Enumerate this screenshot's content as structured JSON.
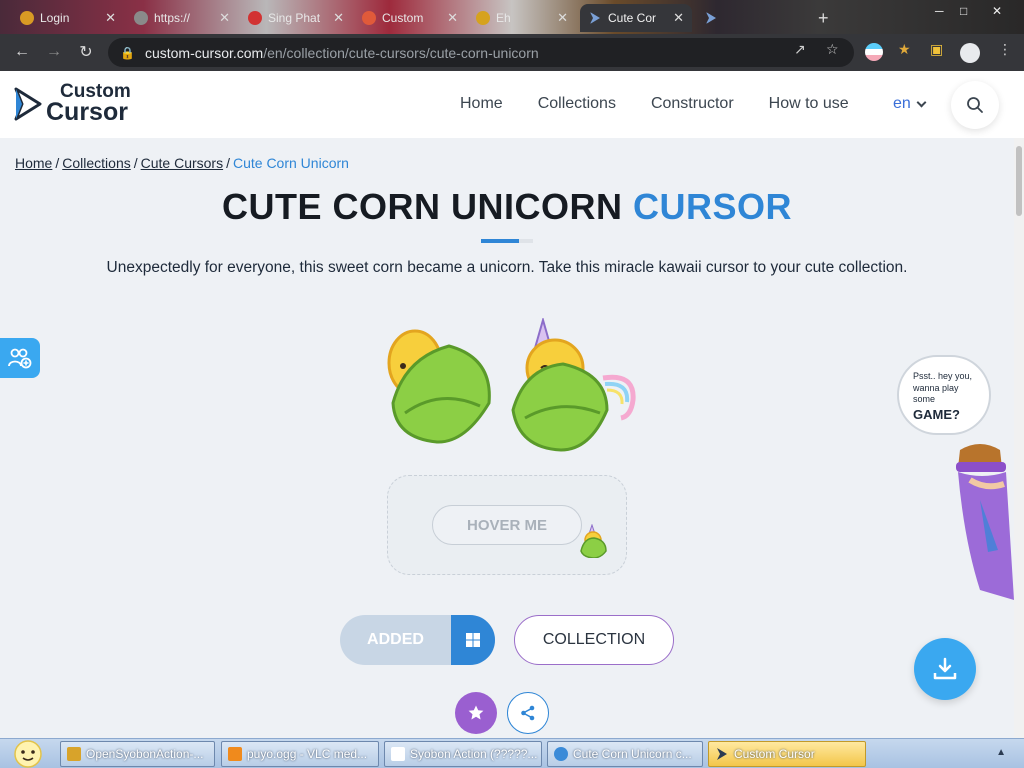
{
  "browser": {
    "tabs": [
      {
        "label": "Login",
        "color": "#d89a24"
      },
      {
        "label": "https://",
        "color": "#8a8a8a"
      },
      {
        "label": "Sing Phat",
        "color": "#d23232"
      },
      {
        "label": "Custom",
        "color": "#e05a3a"
      },
      {
        "label": "Eh",
        "color": "#d6a21e"
      },
      {
        "label": "Cute Cor",
        "color": "#7aa0d6",
        "active": true
      },
      {
        "label": "",
        "color": "#7aa0d6"
      }
    ],
    "close_glyph": "✕",
    "new_tab_glyph": "+",
    "url_host": "custom-cursor.com",
    "url_path": "/en/collection/cute-cursors/cute-corn-unicorn",
    "icons": [
      "back-icon",
      "forward-icon",
      "reload-icon",
      "lock-icon",
      "share-icon",
      "star-icon",
      "extensions-icon",
      "sidepanel-icon",
      "profile-icon",
      "menu-icon"
    ]
  },
  "site": {
    "logo_line1": "Custom",
    "logo_line2": "Cursor",
    "nav": [
      "Home",
      "Collections",
      "Constructor",
      "How to use"
    ],
    "lang": "en",
    "accent_color": "#2f86d6"
  },
  "breadcrumb": {
    "items": [
      "Home",
      "Collections",
      "Cute Cursors"
    ],
    "separator": "/",
    "current": "Cute Corn Unicorn"
  },
  "page": {
    "title_main": "CUTE CORN UNICORN",
    "title_accent": "CURSOR",
    "description": "Unexpectedly for everyone, this sweet corn became a unicorn. Take this miracle kawaii cursor to your cute collection.",
    "hover_label": "HOVER ME",
    "added_label": "ADDED",
    "collection_label": "COLLECTION",
    "speech_line1": "Psst.. hey you,",
    "speech_line2": "wanna play some",
    "speech_line3": "GAME?"
  },
  "taskbar": {
    "tasks": [
      {
        "label": "OpenSyobonAction-...",
        "color": "#d8a32a"
      },
      {
        "label": "puyo.ogg - VLC med...",
        "color": "#f08a1c"
      },
      {
        "label": "Syobon Action (?????...",
        "color": "#ffffff"
      },
      {
        "label": "Cute Corn Unicorn c...",
        "color": "#3b8bd8"
      },
      {
        "label": "Custom Cursor",
        "color": "#2b3b52",
        "active": true
      }
    ]
  }
}
